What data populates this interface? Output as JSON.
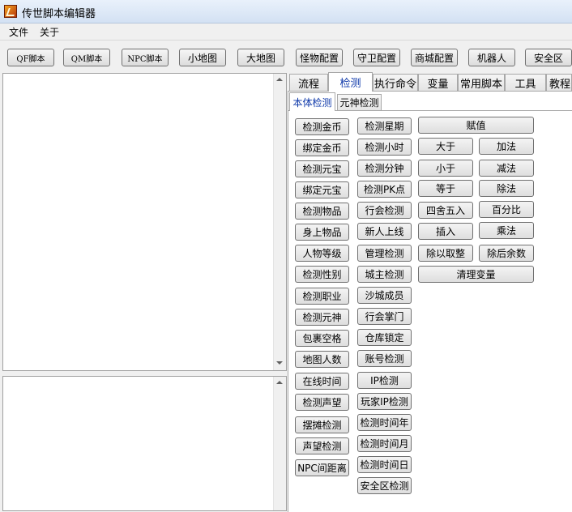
{
  "window": {
    "title": "传世脚本编辑器"
  },
  "menu": {
    "file": "文件",
    "about": "关于"
  },
  "toolbar": {
    "qf": "QF脚本",
    "qm": "QM脚本",
    "npc": "NPC脚本",
    "minimap": "小地图",
    "bigmap": "大地图",
    "monster": "怪物配置",
    "guard": "守卫配置",
    "shop": "商城配置",
    "robot": "机器人",
    "safezone": "安全区"
  },
  "tabs": [
    "流程",
    "检测",
    "执行命令",
    "变量",
    "常用脚本",
    "工具",
    "教程"
  ],
  "subtabs": [
    "本体检测",
    "元神检测"
  ],
  "col1": [
    "检测金币",
    "绑定金币",
    "检测元宝",
    "绑定元宝",
    "检测物品",
    "身上物品",
    "人物等级",
    "检测性别",
    "检测职业",
    "检测元神",
    "包裹空格",
    "地图人数",
    "在线时间",
    "检测声望",
    "摆摊检测",
    "声望检测",
    "NPC间距离"
  ],
  "col2": [
    "检测星期",
    "检测小时",
    "检测分钟",
    "检测PK点",
    "行会检测",
    "新人上线",
    "管理检测",
    "城主检测",
    "沙城成员",
    "行会掌门",
    "仓库锁定",
    "账号检测",
    "IP检测",
    "玩家IP检测",
    "检测时间年",
    "检测时间月",
    "检测时间日",
    "安全区检测"
  ],
  "ops": {
    "assign": "赋值",
    "greater": "大于",
    "add": "加法",
    "less": "小于",
    "subtract": "减法",
    "equal": "等于",
    "divide": "除法",
    "round": "四舍五入",
    "percent": "百分比",
    "insert": "插入",
    "multiply": "乘法",
    "div_floor": "除以取整",
    "remainder": "除后余数",
    "clear_vars": "清理变量"
  }
}
